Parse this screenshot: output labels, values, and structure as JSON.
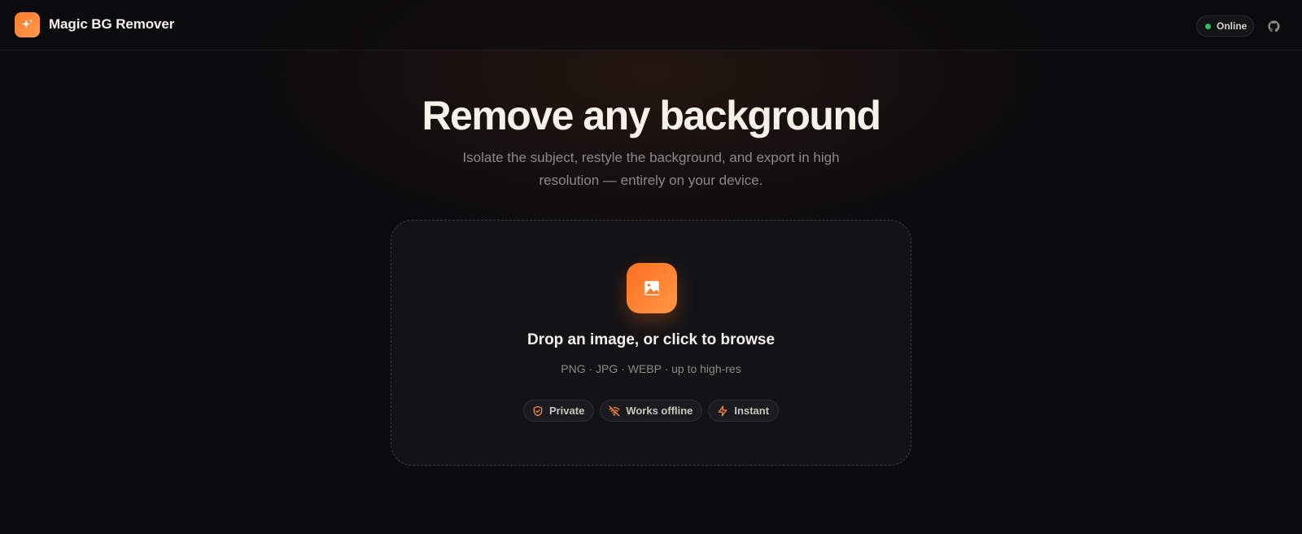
{
  "app": {
    "name": "Magic BG Remover",
    "logo_icon": "sparkles-icon",
    "accent_color": "#ff7a2b"
  },
  "header": {
    "status_label": "Online",
    "status_color": "#22c55e",
    "github_icon": "github-icon"
  },
  "hero": {
    "title": "Remove any background",
    "subtitle": "Isolate the subject, restyle the background, and export in high resolution — entirely on your device."
  },
  "dropzone": {
    "icon": "image-icon",
    "title": "Drop an image, or click to browse",
    "formats": "PNG · JPG · WEBP · up to high-res",
    "features": [
      {
        "label": "Private",
        "icon": "shield-check-icon"
      },
      {
        "label": "Works offline",
        "icon": "wifi-off-icon"
      },
      {
        "label": "Instant",
        "icon": "zap-icon"
      }
    ]
  }
}
